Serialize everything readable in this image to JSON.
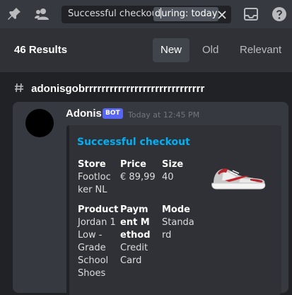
{
  "toolbar": {
    "icons": [
      "pin-icon",
      "members-icon",
      "inbox-icon",
      "help-icon"
    ]
  },
  "search": {
    "query": "Successful checkout",
    "filter_before_caret": "d",
    "filter_after_caret": "uring: today"
  },
  "results": {
    "count_label": "46 Results",
    "tabs": [
      {
        "label": "New",
        "active": true
      },
      {
        "label": "Old",
        "active": false
      },
      {
        "label": "Relevant",
        "active": false
      }
    ]
  },
  "channel": {
    "name": "adonisgobrrrrrrrrrrrrrrrrrrrrrrrrrrrrr"
  },
  "message": {
    "author": "Adonis",
    "badge": "BOT",
    "timestamp": "Today at 12:45 PM",
    "embed": {
      "title": "Successful checkout",
      "border_color": "#202225",
      "fields": [
        {
          "name": "Store",
          "value": "Footlocker NL"
        },
        {
          "name": "Price",
          "value": "€ 89,99"
        },
        {
          "name": "Size",
          "value": "40"
        },
        {
          "name": "Product",
          "value": "Jordan 1 Low - Grade School Shoes"
        },
        {
          "name": "Payment Method",
          "value": "Credit Card"
        },
        {
          "name": "Mode",
          "value": "Standard"
        }
      ],
      "thumbnail": "sneaker-image"
    }
  },
  "colors": {
    "accent": "#5865f2",
    "link": "#00b0f4",
    "background": "#202225"
  }
}
